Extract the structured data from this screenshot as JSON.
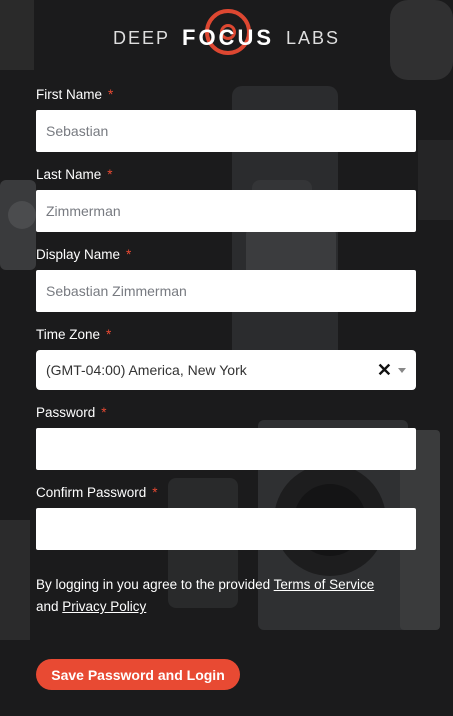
{
  "brand": {
    "left": "DEEP",
    "center": "FOCUS",
    "right": "LABS",
    "accent_color": "#e84a33"
  },
  "form": {
    "first_name": {
      "label": "First Name",
      "value": "Sebastian",
      "required_mark": "*"
    },
    "last_name": {
      "label": "Last Name",
      "value": "Zimmerman",
      "required_mark": "*"
    },
    "display_name": {
      "label": "Display Name",
      "value": "Sebastian Zimmerman",
      "required_mark": "*"
    },
    "time_zone": {
      "label": "Time Zone",
      "value": "(GMT-04:00) America, New York",
      "required_mark": "*",
      "clear_icon": "✕"
    },
    "password": {
      "label": "Password",
      "value": "",
      "required_mark": "*"
    },
    "confirm_password": {
      "label": "Confirm Password",
      "value": "",
      "required_mark": "*"
    }
  },
  "legal": {
    "prefix": "By logging in you agree to the provided ",
    "terms_link": "Terms of Service",
    "middle": "and ",
    "privacy_link": "Privacy Policy"
  },
  "submit_label": "Save Password and Login"
}
